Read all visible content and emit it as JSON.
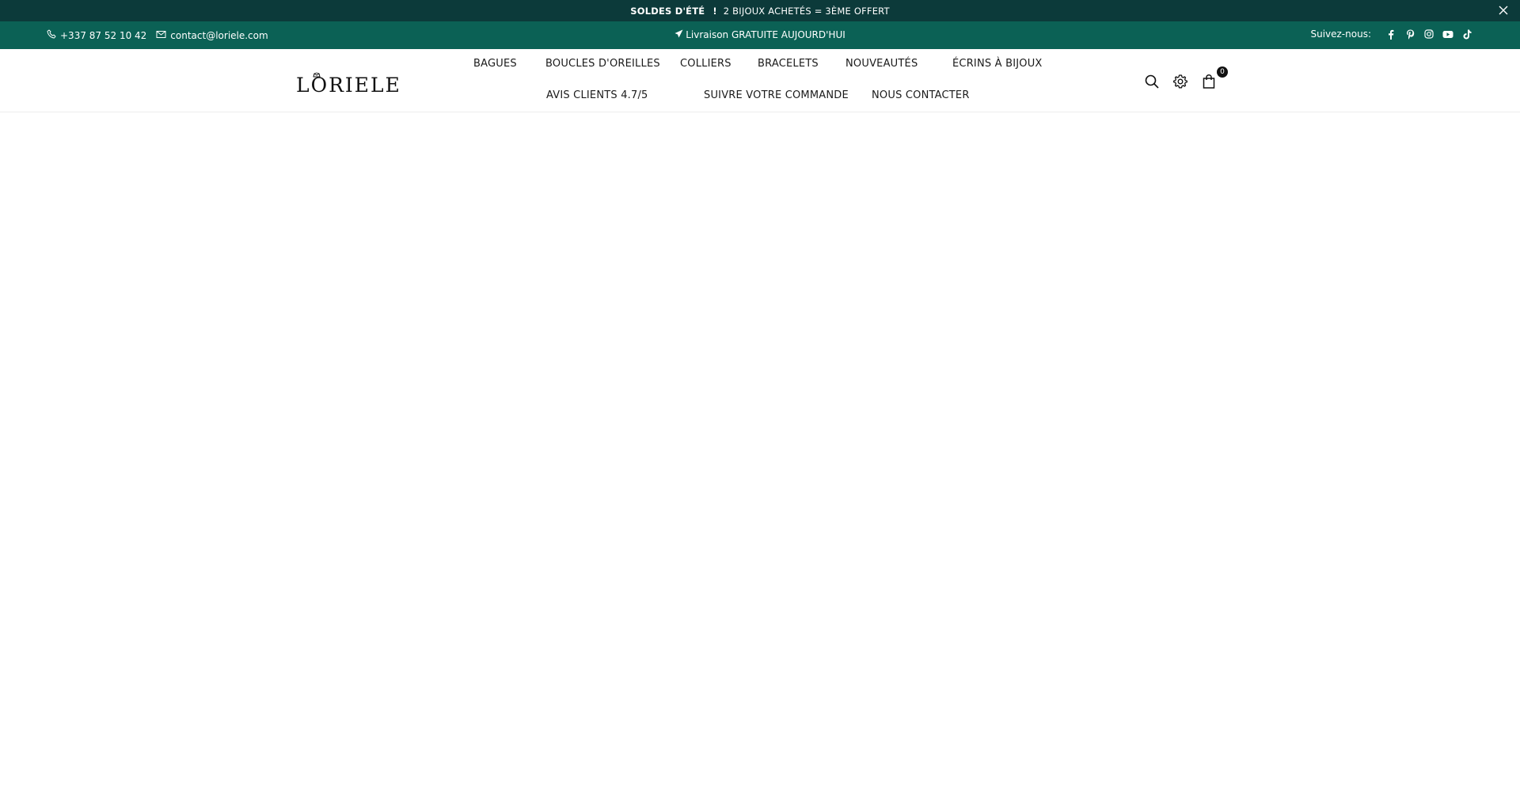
{
  "announcement": {
    "bold": "SOLDES D'ÉTÉ",
    "exclaim": "!",
    "text": "2 BIJOUX ACHETÉS = 3ÈME OFFERT",
    "close_icon": "close-icon"
  },
  "topbar": {
    "phone": "+337 87 52 10 42",
    "email": "contact@loriele.com",
    "shipping": "Livraison GRATUITE AUJOURD'HUI",
    "follow_label": "Suivez-nous:",
    "socials": [
      "facebook-icon",
      "pinterest-icon",
      "instagram-icon",
      "youtube-icon",
      "tiktok-icon"
    ],
    "colors": {
      "announcement_bg": "#0c3a3a",
      "topbar_bg": "#0b6155"
    }
  },
  "header": {
    "logo": "LORIELE",
    "nav": [
      "BAGUES",
      "BOUCLES D'OREILLES",
      "COLLIERS",
      "BRACELETS",
      "NOUVEAUTÉS",
      "ÉCRINS À BIJOUX",
      "AVIS CLIENTS 4.7/5",
      "SUIVRE VOTRE COMMANDE",
      "NOUS CONTACTER"
    ],
    "cart_count": "0"
  }
}
